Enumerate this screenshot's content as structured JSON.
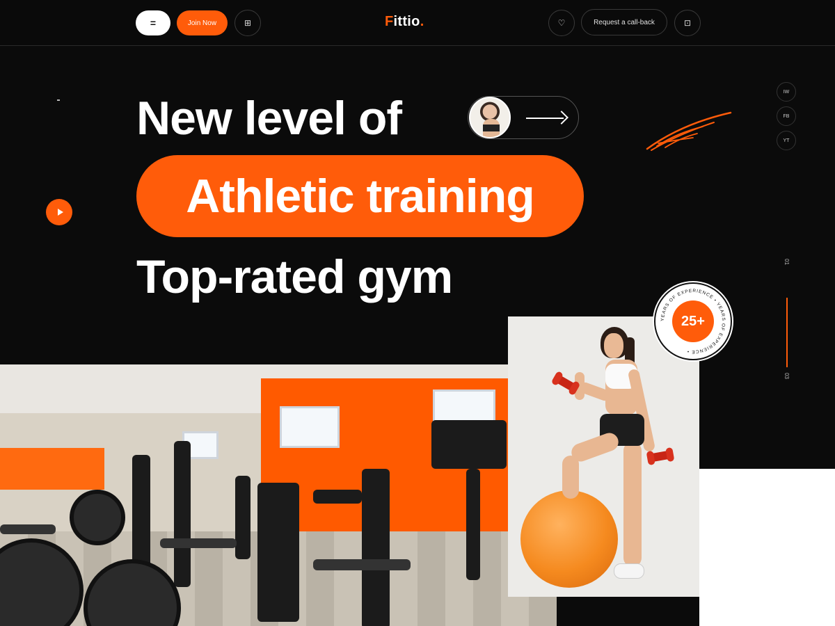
{
  "header": {
    "menu_label": "=",
    "join_label": "Join Now",
    "book_icon_glyph": "⊞",
    "logo_first": "F",
    "logo_rest": "ittio",
    "logo_dot": ".",
    "heart_icon_glyph": "♡",
    "callback_label": "Request a call-back",
    "cart_icon_glyph": "⊡"
  },
  "hero": {
    "line1": "New level of",
    "line2": "Athletic training",
    "line3": "Top-rated gym"
  },
  "social": [
    {
      "label": "IW"
    },
    {
      "label": "FB"
    },
    {
      "label": "YT"
    }
  ],
  "slider": {
    "current": "01",
    "total": "03"
  },
  "badge": {
    "value": "25+",
    "ring_text": "YEARS OF EXPERIENCE • YEARS OF EXPERIENCE • "
  },
  "colors": {
    "accent": "#ff5c0a",
    "background": "#0b0b0b"
  },
  "icons": {
    "menu": "menu-icon",
    "book": "book-icon",
    "heart": "heart-icon",
    "cart": "cart-icon",
    "play": "play-icon",
    "arrow": "arrow-right-icon"
  }
}
